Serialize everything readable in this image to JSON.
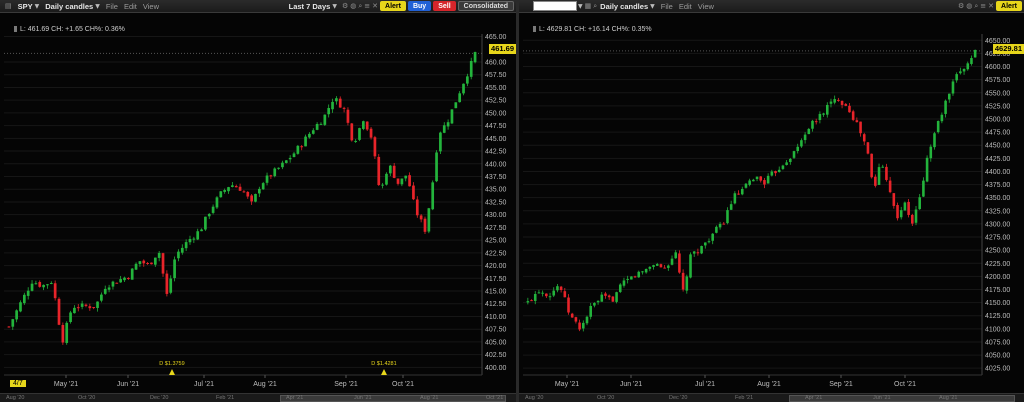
{
  "left_chart": {
    "symbol": "SPY",
    "interval": "Daily candles",
    "menu": [
      "File",
      "Edit",
      "View"
    ],
    "range": "Last 7 Days",
    "buttons": {
      "alert": "Alert",
      "buy": "Buy",
      "sell": "Sell",
      "consolidated": "Consolidated"
    },
    "ohlc_line": "L: 461.69 CH: +1.65 CH%: 0.36%",
    "last_price": "461.69",
    "date_badge": "4/7",
    "dividends": [
      "D $1.3759",
      "D $1.4281"
    ],
    "overview_labels": [
      "Aug '20",
      "Oct '20",
      "Dec '20",
      "Feb '21",
      "Apr '21",
      "Jun '21",
      "Aug '21",
      "Oct '21"
    ]
  },
  "right_chart": {
    "interval": "Daily candles",
    "menu": [
      "File",
      "Edit",
      "View"
    ],
    "buttons": {
      "alert": "Alert"
    },
    "ohlc_line": "L: 4629.81 CH: +16.14 CH%: 0.35%",
    "last_price": "4629.81",
    "overview_labels": [
      "Aug '20",
      "Oct '20",
      "Dec '20",
      "Feb '21",
      "Apr '21",
      "Jun '21",
      "Aug '21"
    ]
  },
  "colors": {
    "up": "#23b43c",
    "down": "#e8242a",
    "accent": "#e7d61b",
    "grid": "#1e1e1e"
  },
  "chart_data": [
    {
      "type": "candlestick",
      "title": "SPY",
      "x_ticks": [
        "May '21",
        "Jun '21",
        "Jul '21",
        "Aug '21",
        "Sep '21",
        "Oct '21"
      ],
      "y_ticks": [
        400.0,
        402.5,
        405.0,
        407.5,
        410.0,
        412.5,
        415.0,
        417.5,
        420.0,
        422.5,
        425.0,
        427.5,
        430.0,
        432.5,
        435.0,
        437.5,
        440.0,
        442.5,
        445.0,
        447.5,
        450.0,
        452.5,
        455.0,
        457.5,
        460.0,
        465.0
      ],
      "ylim": [
        398.5,
        465.5
      ],
      "close_path": [
        [
          0,
          408
        ],
        [
          6,
          412
        ],
        [
          14,
          417
        ],
        [
          20,
          416
        ],
        [
          26,
          417
        ],
        [
          32,
          405
        ],
        [
          38,
          412
        ],
        [
          46,
          412
        ],
        [
          52,
          412
        ],
        [
          58,
          416
        ],
        [
          65,
          417
        ],
        [
          72,
          418
        ],
        [
          78,
          421
        ],
        [
          84,
          420
        ],
        [
          90,
          423
        ],
        [
          95,
          414
        ],
        [
          100,
          422
        ],
        [
          108,
          425
        ],
        [
          115,
          427
        ],
        [
          121,
          431
        ],
        [
          127,
          434
        ],
        [
          133,
          436
        ],
        [
          140,
          435
        ],
        [
          146,
          432
        ],
        [
          151,
          436
        ],
        [
          158,
          438
        ],
        [
          165,
          440
        ],
        [
          171,
          442
        ],
        [
          176,
          444
        ],
        [
          183,
          447
        ],
        [
          189,
          449
        ],
        [
          195,
          453
        ],
        [
          201,
          451
        ],
        [
          207,
          444
        ],
        [
          213,
          449
        ],
        [
          218,
          445
        ],
        [
          223,
          434
        ],
        [
          228,
          440
        ],
        [
          234,
          436
        ],
        [
          239,
          438
        ],
        [
          244,
          431
        ],
        [
          250,
          427
        ],
        [
          254,
          435
        ],
        [
          258,
          446
        ],
        [
          263,
          448
        ],
        [
          268,
          452
        ],
        [
          273,
          456
        ],
        [
          277,
          459
        ],
        [
          280,
          461.69
        ]
      ]
    },
    {
      "type": "candlestick",
      "title": "",
      "x_ticks": [
        "May '21",
        "Jun '21",
        "Jul '21",
        "Aug '21",
        "Sep '21",
        "Oct '21"
      ],
      "y_ticks": [
        4025.0,
        4050.0,
        4075.0,
        4100.0,
        4125.0,
        4150.0,
        4175.0,
        4200.0,
        4225.0,
        4250.0,
        4275.0,
        4300.0,
        4325.0,
        4350.0,
        4375.0,
        4400.0,
        4425.0,
        4450.0,
        4475.0,
        4500.0,
        4525.0,
        4550.0,
        4575.0,
        4600.0,
        4625.0,
        4650.0
      ],
      "ylim": [
        4012,
        4662
      ],
      "close_path": [
        [
          0,
          4150
        ],
        [
          8,
          4175
        ],
        [
          16,
          4165
        ],
        [
          24,
          4185
        ],
        [
          32,
          4125
        ],
        [
          40,
          4100
        ],
        [
          48,
          4140
        ],
        [
          56,
          4160
        ],
        [
          64,
          4155
        ],
        [
          72,
          4185
        ],
        [
          80,
          4200
        ],
        [
          88,
          4210
        ],
        [
          96,
          4225
        ],
        [
          104,
          4215
        ],
        [
          112,
          4245
        ],
        [
          118,
          4170
        ],
        [
          124,
          4240
        ],
        [
          132,
          4255
        ],
        [
          140,
          4280
        ],
        [
          148,
          4300
        ],
        [
          156,
          4350
        ],
        [
          164,
          4365
        ],
        [
          172,
          4390
        ],
        [
          180,
          4380
        ],
        [
          188,
          4400
        ],
        [
          196,
          4420
        ],
        [
          204,
          4440
        ],
        [
          212,
          4480
        ],
        [
          220,
          4500
        ],
        [
          228,
          4525
        ],
        [
          236,
          4540
        ],
        [
          244,
          4520
        ],
        [
          252,
          4480
        ],
        [
          258,
          4440
        ],
        [
          263,
          4360
        ],
        [
          268,
          4420
        ],
        [
          274,
          4380
        ],
        [
          280,
          4310
        ],
        [
          286,
          4340
        ],
        [
          292,
          4300
        ],
        [
          298,
          4350
        ],
        [
          304,
          4430
        ],
        [
          310,
          4480
        ],
        [
          316,
          4520
        ],
        [
          322,
          4560
        ],
        [
          328,
          4590
        ],
        [
          334,
          4605
        ],
        [
          340,
          4629.81
        ]
      ]
    }
  ]
}
